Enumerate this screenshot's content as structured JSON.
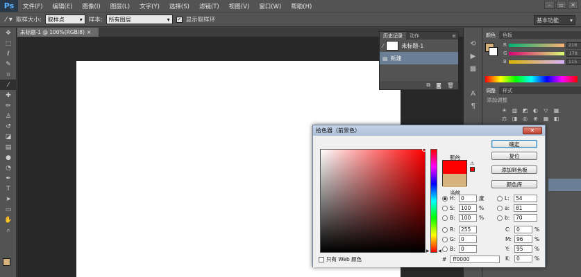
{
  "app": {
    "logo": "Ps"
  },
  "menu": [
    "文件(F)",
    "编辑(E)",
    "图像(I)",
    "图层(L)",
    "文字(Y)",
    "选择(S)",
    "滤镜(T)",
    "视图(V)",
    "窗口(W)",
    "帮助(H)"
  ],
  "options_bar": {
    "sample_size_label": "取样大小:",
    "sample_size_value": "取样点",
    "sample_label": "样本:",
    "sample_value": "所有图层",
    "show_ring_label": "显示取样环",
    "workspace": "基本功能"
  },
  "document": {
    "tab_title": "未标题-1 @ 100%(RGB/8)",
    "close": "×"
  },
  "history_panel": {
    "tabs": [
      "历史记录",
      "动作"
    ],
    "snapshot_label": "未标题-1",
    "step_label": "新建"
  },
  "color_panel": {
    "tabs": [
      "颜色",
      "色板"
    ],
    "sliders": [
      {
        "label": "R",
        "value": "218"
      },
      {
        "label": "G",
        "value": "178"
      },
      {
        "label": "B",
        "value": "115"
      }
    ]
  },
  "adjust_panel": {
    "tabs": [
      "调整",
      "样式"
    ],
    "subtitle": "添加调整"
  },
  "picker": {
    "title": "拾色器（前景色）",
    "close": "✕",
    "new_label": "新的",
    "current_label": "当前",
    "only_web_label": "只有 Web 颜色",
    "buttons": {
      "ok": "确定",
      "reset": "复位",
      "add_swatch": "添加到色板",
      "libraries": "颜色库"
    },
    "hsb": [
      {
        "label": "H:",
        "value": "0",
        "unit": "度",
        "selected": true
      },
      {
        "label": "S:",
        "value": "100",
        "unit": "%",
        "selected": false
      },
      {
        "label": "B:",
        "value": "100",
        "unit": "%",
        "selected": false
      }
    ],
    "rgb": [
      {
        "label": "R:",
        "value": "255"
      },
      {
        "label": "G:",
        "value": "0"
      },
      {
        "label": "B:",
        "value": "0"
      }
    ],
    "lab": [
      {
        "label": "L:",
        "value": "54"
      },
      {
        "label": "a:",
        "value": "81"
      },
      {
        "label": "b:",
        "value": "70"
      }
    ],
    "cmyk": [
      {
        "label": "C:",
        "value": "0",
        "unit": "%"
      },
      {
        "label": "M:",
        "value": "96",
        "unit": "%"
      },
      {
        "label": "Y:",
        "value": "95",
        "unit": "%"
      },
      {
        "label": "K:",
        "value": "0",
        "unit": "%"
      }
    ],
    "hex_label": "#",
    "hex_value": "ff0000",
    "new_color": "#ff0000",
    "current_color": "#d6b37c"
  },
  "colors": {
    "foreground": "#d6b37c",
    "background": "#ffffff",
    "selection": "#6a7f96"
  }
}
